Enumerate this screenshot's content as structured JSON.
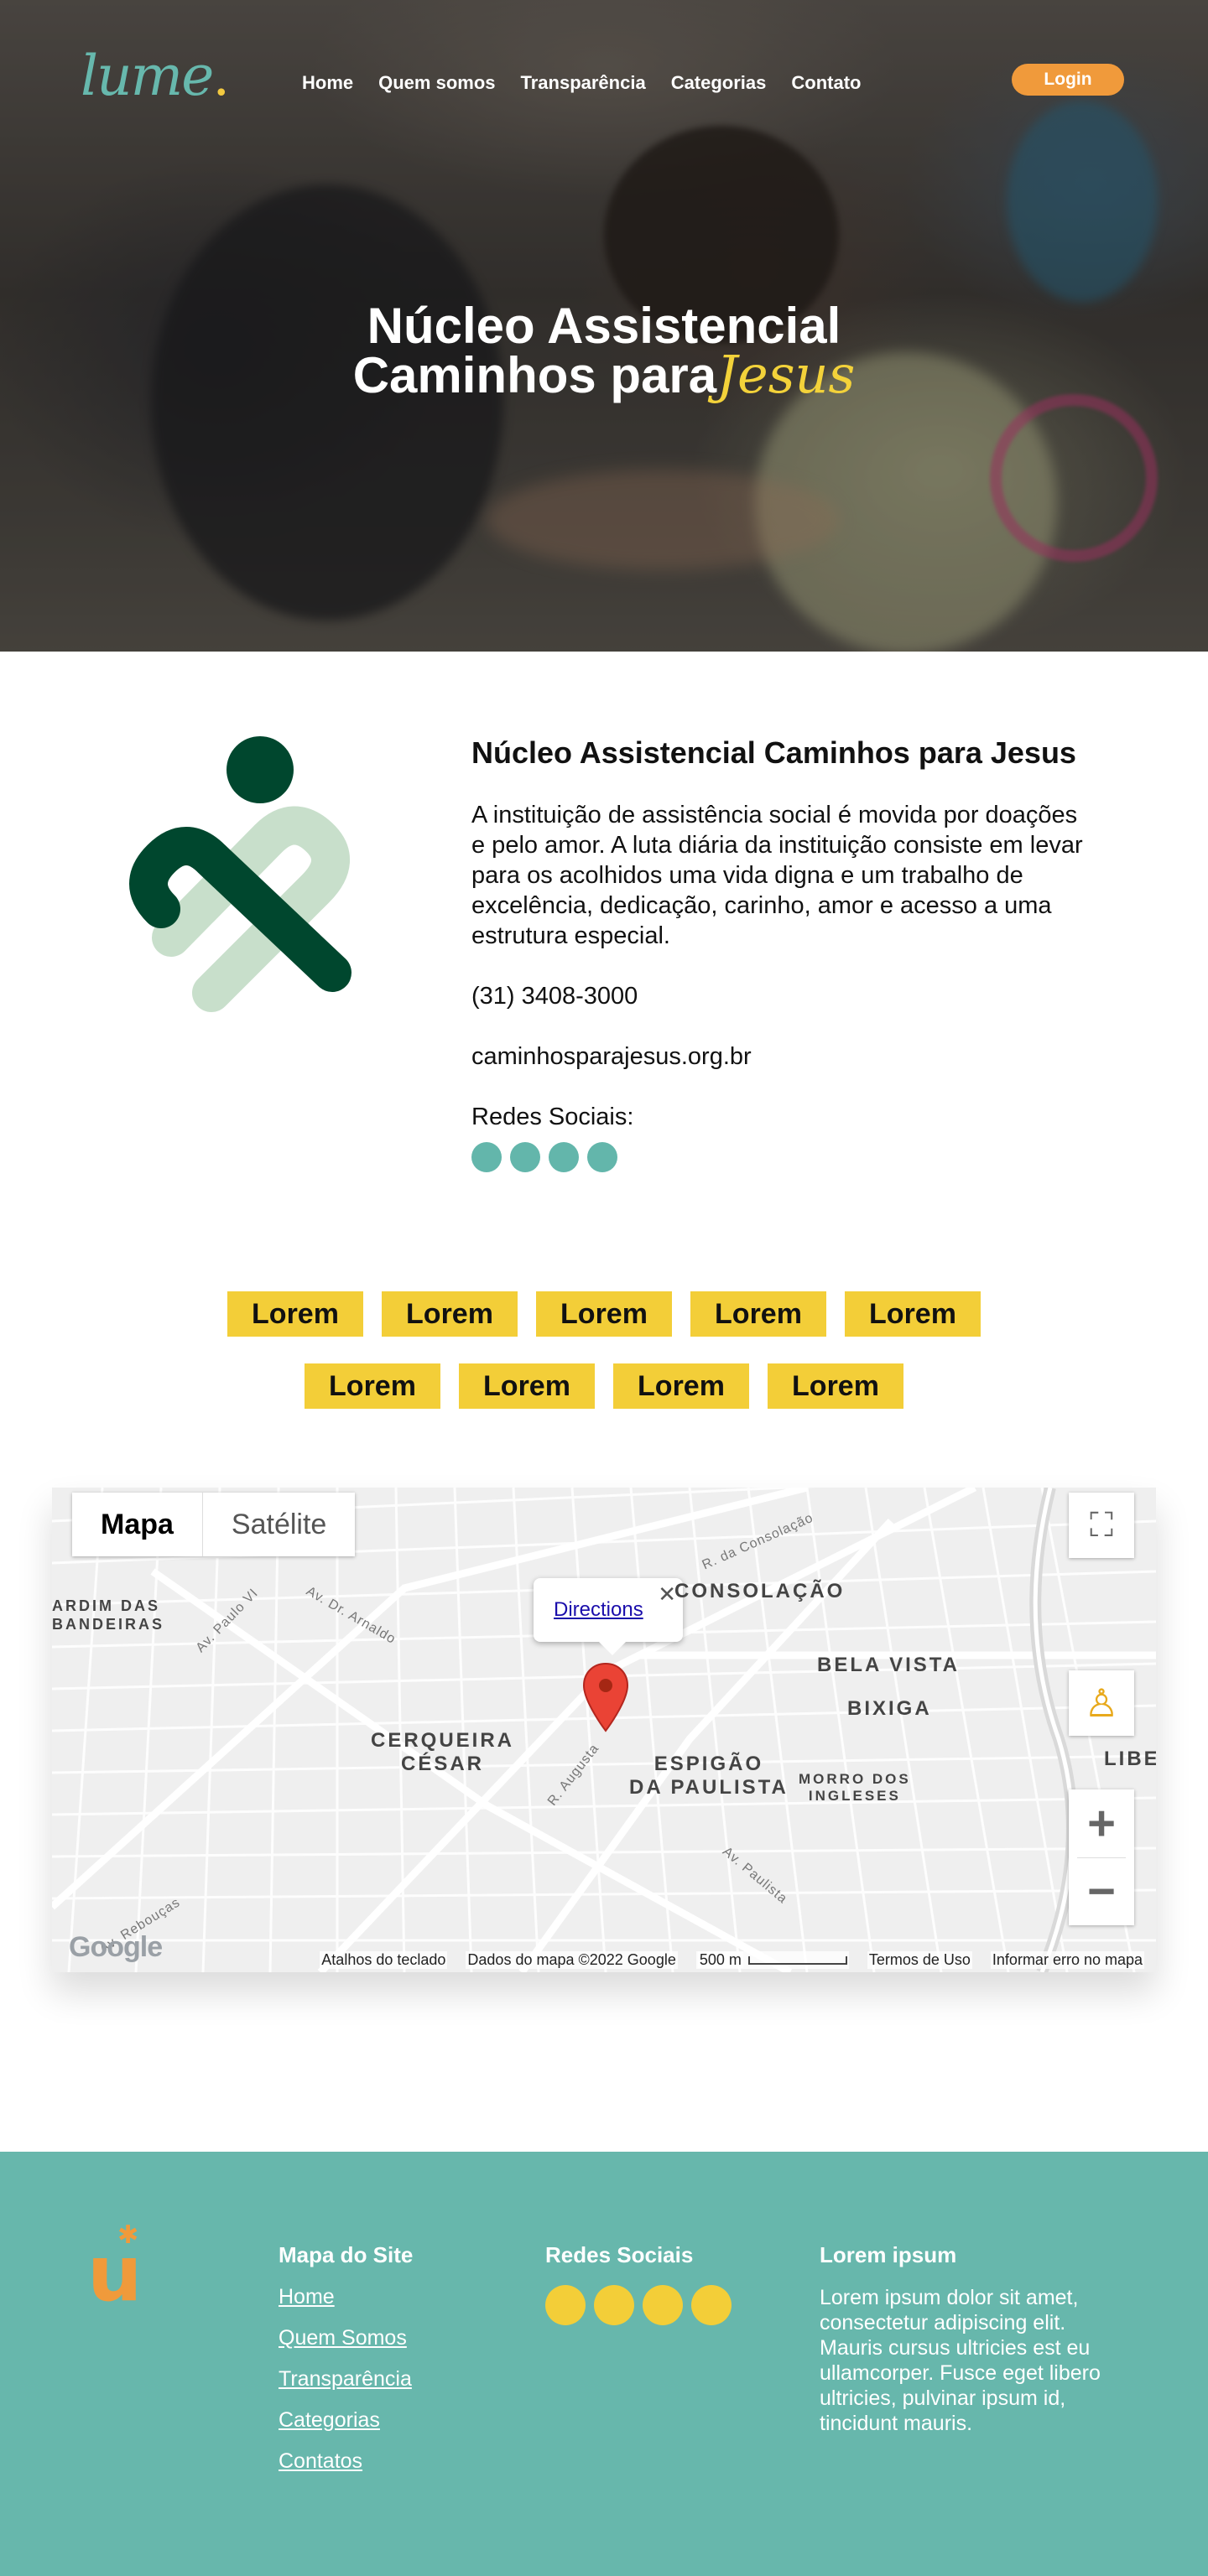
{
  "header": {
    "logo_text": "lume",
    "logo_dot": ".",
    "nav": [
      {
        "label": "Home"
      },
      {
        "label": "Quem somos"
      },
      {
        "label": "Transparência"
      },
      {
        "label": "Categorias"
      },
      {
        "label": "Contato"
      }
    ],
    "login_label": "Login"
  },
  "hero": {
    "title_line1": "Núcleo Assistencial",
    "title_line2": "Caminhos para",
    "title_script": "Jesus"
  },
  "organization": {
    "name": "Núcleo Assistencial Caminhos para Jesus",
    "description": "A instituição de assistência social é movida por doações e pelo amor. A luta diária da instituição consiste em levar para os acolhidos uma vida digna e um trabalho de excelência, dedicação, carinho, amor e acesso a uma estrutura especial.",
    "phone": "(31) 3408-3000",
    "website": "caminhosparajesus.org.br",
    "social_label": "Redes Sociais:",
    "social_icons": [
      "social-icon-1",
      "social-icon-2",
      "social-icon-3",
      "social-icon-4"
    ]
  },
  "tags": {
    "row1": [
      "Lorem",
      "Lorem",
      "Lorem",
      "Lorem",
      "Lorem"
    ],
    "row2": [
      "Lorem",
      "Lorem",
      "Lorem",
      "Lorem"
    ]
  },
  "map": {
    "type_map": "Mapa",
    "type_satellite": "Satélite",
    "popup_link": "Directions",
    "districts": {
      "consolacao": "CONSOLAÇÃO",
      "bela_vista": "BELA VISTA",
      "bixiga": "BIXIGA",
      "cerqueira": "CERQUEIRA\nCÉSAR",
      "espigao": "ESPIGÃO\nDA PAULISTA",
      "morro": "MORRO DOS\nINGLESES",
      "jardim": "ARDIM DAS\nBANDEIRAS",
      "libe": "LIBE"
    },
    "streets": {
      "consolacao": "R. da Consolação",
      "paulo_vi": "Av. Paulo VI",
      "arnaldo": "Av. Dr. Arnaldo",
      "augusta": "R. Augusta",
      "paulista": "Av. Paulista",
      "reboucas": "Av. Rebouças"
    },
    "footer": {
      "shortcuts": "Atalhos do teclado",
      "data": "Dados do mapa ©2022 Google",
      "scale": "500 m",
      "terms": "Termos de Uso",
      "report": "Informar erro no mapa"
    },
    "google_logo": "Google"
  },
  "footer": {
    "logo_text": "u",
    "sitemap_title": "Mapa do Site",
    "sitemap_links": [
      "Home",
      "Quem Somos",
      "Transparência",
      "Categorias",
      "Contatos"
    ],
    "social_title": "Redes Sociais",
    "social_icons": [
      "social-icon-1",
      "social-icon-2",
      "social-icon-3",
      "social-icon-4"
    ],
    "lorem_title": "Lorem ipsum",
    "lorem_text": "Lorem ipsum dolor sit amet, consectetur adipiscing elit. Mauris cursus ultricies est eu ullamcorper. Fusce eget libero ultricies, pulvinar ipsum id, tincidunt mauris."
  },
  "colors": {
    "teal": "#67b7ac",
    "yellow": "#f3ce38",
    "orange": "#f09a3b",
    "dark_green": "#00472e",
    "light_green": "#c8dfcb"
  }
}
